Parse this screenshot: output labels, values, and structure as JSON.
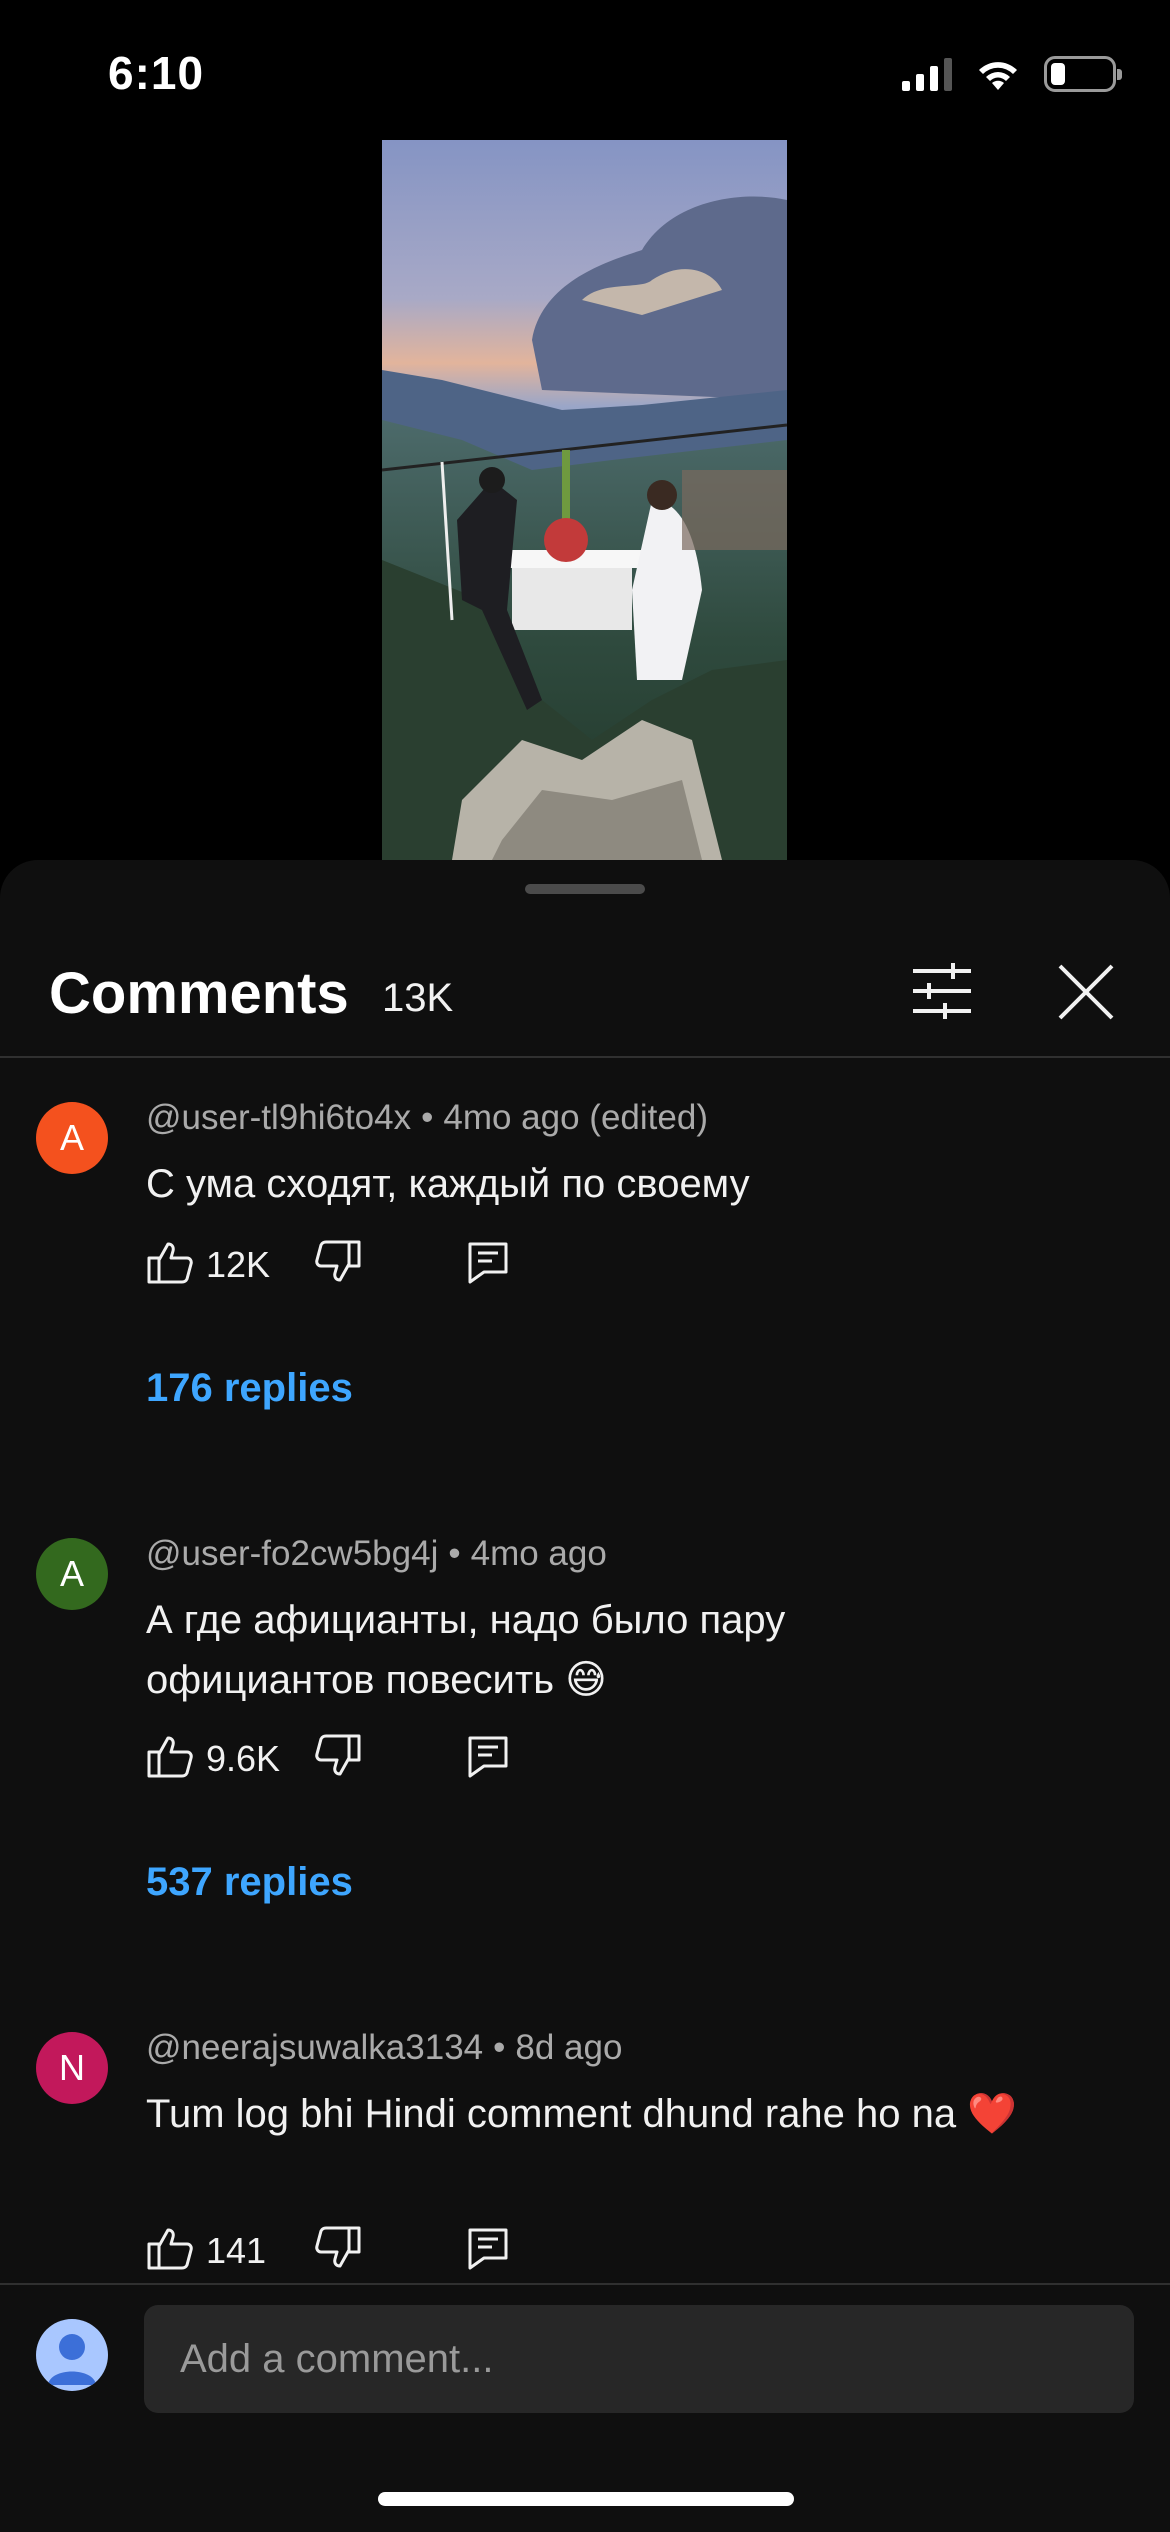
{
  "status_bar": {
    "time": "6:10"
  },
  "sheet": {
    "title": "Comments",
    "count": "13K",
    "comments": [
      {
        "avatar_letter": "A",
        "avatar_color": "#f4511e",
        "author": "@user-tl9hi6to4x",
        "time": "4mo ago (edited)",
        "text": "С ума сходят, каждый по своему",
        "likes": "12K",
        "replies": "176 replies"
      },
      {
        "avatar_letter": "A",
        "avatar_color": "#33691e",
        "author": "@user-fo2cw5bg4j",
        "time": "4mo ago",
        "text": "А где афицианты, надо было пару официантов повесить 😅",
        "likes": "9.6K",
        "replies": "537 replies"
      },
      {
        "avatar_letter": "N",
        "avatar_color": "#c2185b",
        "author": "@neerajsuwalka3134",
        "time": "8d ago",
        "text": "Tum log bhi Hindi comment dhund rahe ho na ❤️",
        "likes": "141",
        "replies": ""
      }
    ],
    "input_placeholder": "Add a comment..."
  },
  "colors": {
    "link": "#3ea6ff",
    "background": "#0f0f0f"
  },
  "icons": [
    "wifi-icon",
    "battery-icon",
    "filter-icon",
    "close-icon",
    "like-icon",
    "dislike-icon",
    "reply-icon"
  ]
}
